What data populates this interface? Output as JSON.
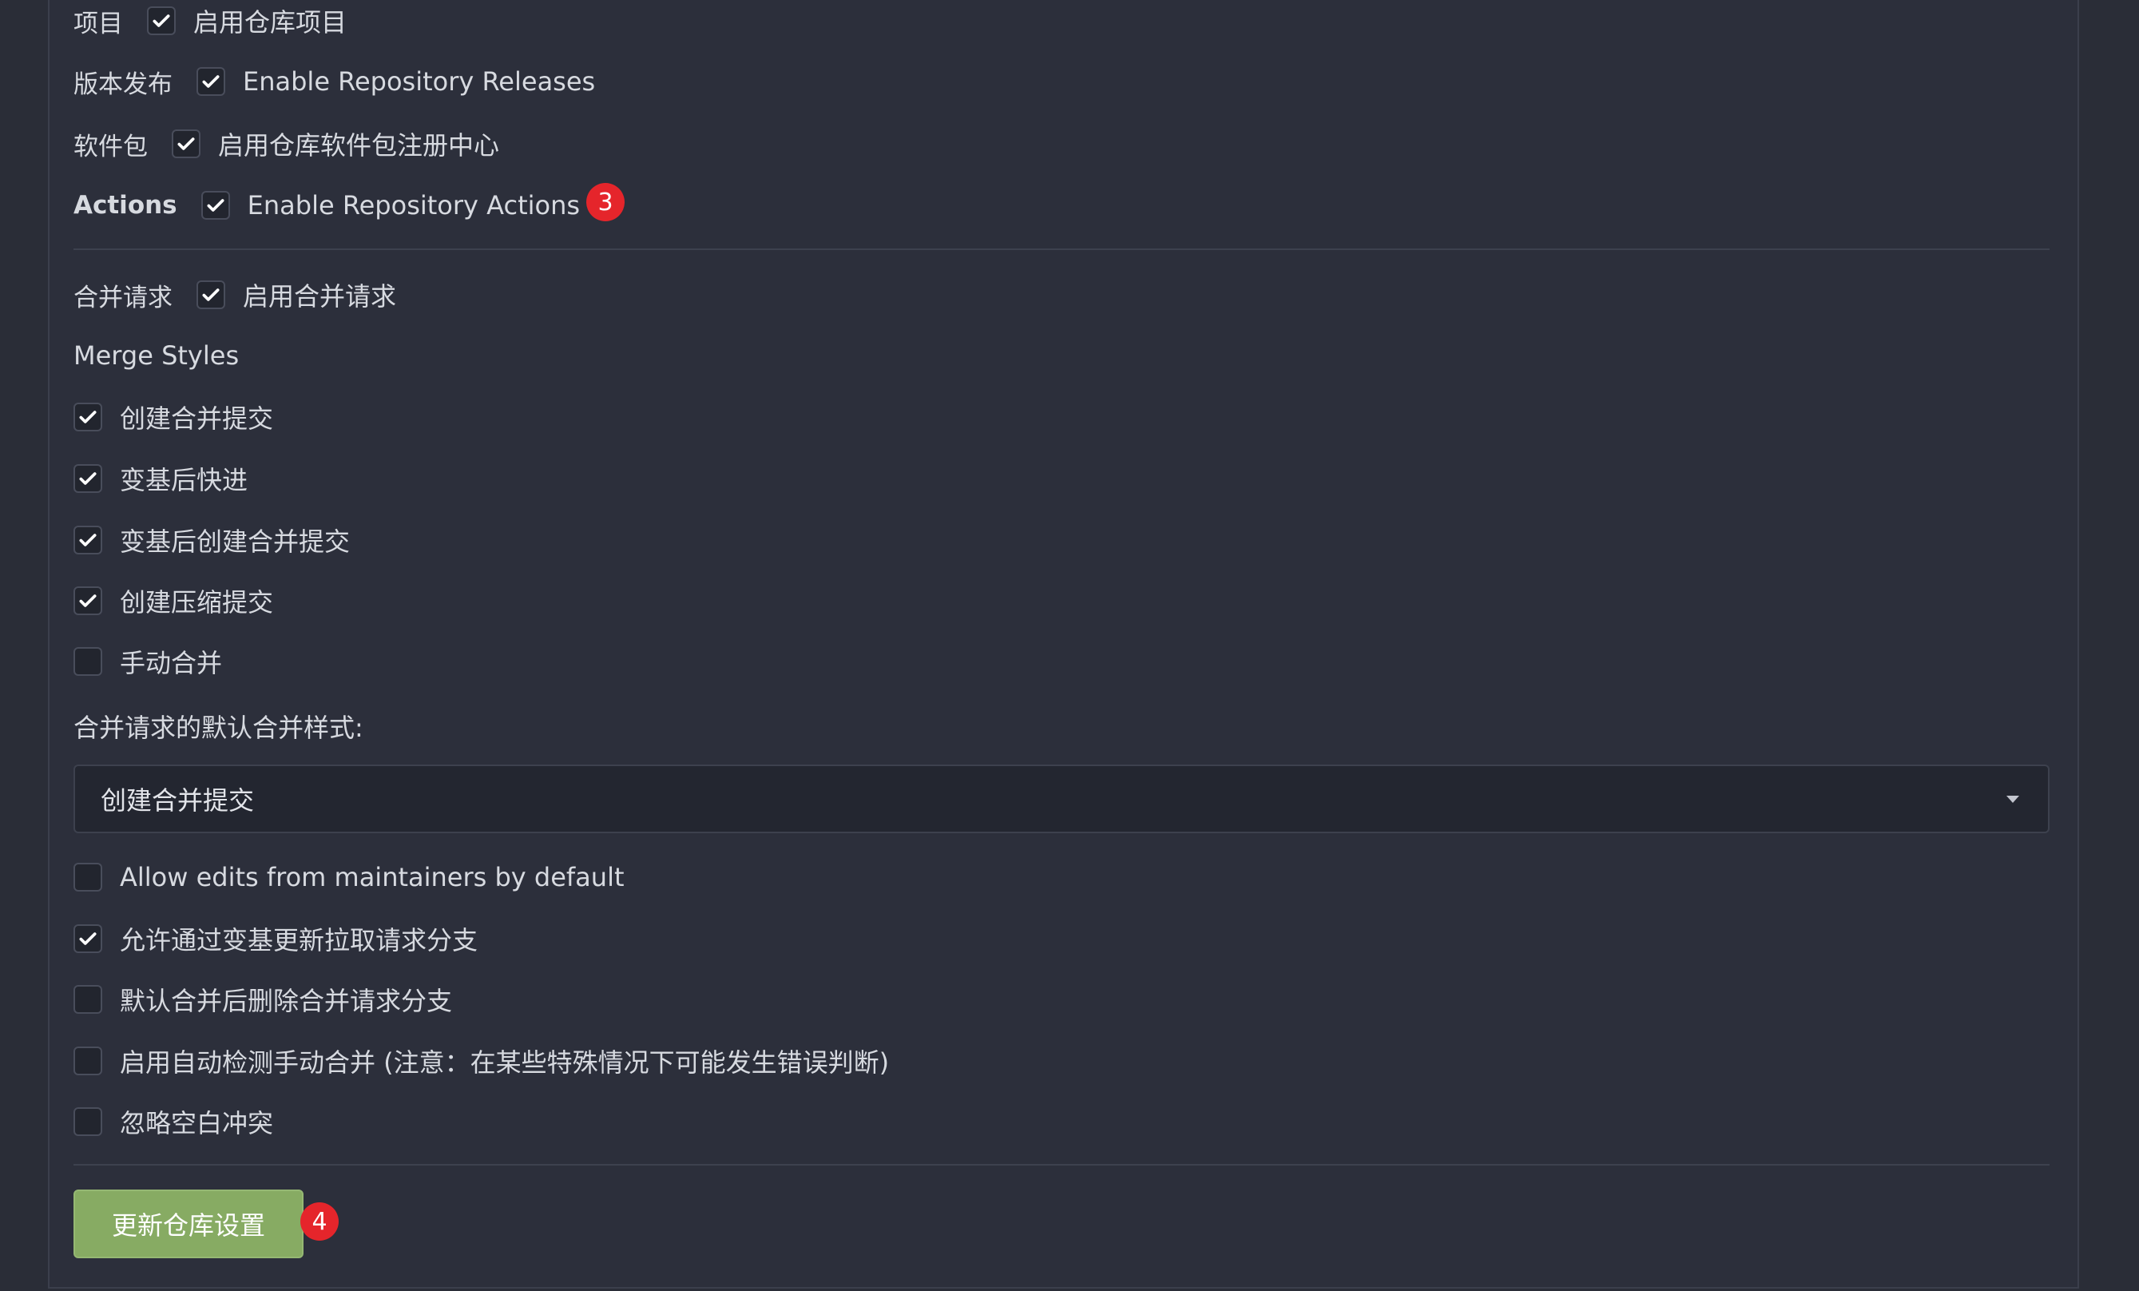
{
  "units": [
    {
      "label": "项目",
      "checked": true,
      "text": "启用仓库项目"
    },
    {
      "label": "版本发布",
      "checked": true,
      "text": "Enable Repository Releases"
    },
    {
      "label": "软件包",
      "checked": true,
      "text": "启用仓库软件包注册中心"
    },
    {
      "label": "Actions",
      "checked": true,
      "text": "Enable Repository Actions",
      "badge": "3"
    }
  ],
  "pull_requests": {
    "label": "合并请求",
    "checked": true,
    "text": "启用合并请求"
  },
  "merge_styles": {
    "title": "Merge Styles",
    "items": [
      {
        "text": "创建合并提交",
        "checked": true
      },
      {
        "text": "变基后快进",
        "checked": true
      },
      {
        "text": "变基后创建合并提交",
        "checked": true
      },
      {
        "text": "创建压缩提交",
        "checked": true
      },
      {
        "text": "手动合并",
        "checked": false
      }
    ]
  },
  "default_merge_style": {
    "label": "合并请求的默认合并样式:",
    "value": "创建合并提交"
  },
  "options": [
    {
      "text": "Allow edits from maintainers by default",
      "checked": false
    },
    {
      "text": "允许通过变基更新拉取请求分支",
      "checked": true
    },
    {
      "text": "默认合并后删除合并请求分支",
      "checked": false
    },
    {
      "text": "启用自动检测手动合并 (注意：在某些特殊情况下可能发生错误判断)",
      "checked": false
    },
    {
      "text": "忽略空白冲突",
      "checked": false
    }
  ],
  "submit": {
    "label": "更新仓库设置",
    "badge": "4"
  },
  "colors": {
    "accent_button": "#87ab63",
    "badge": "#e5252b",
    "background": "#2c2f3b"
  }
}
